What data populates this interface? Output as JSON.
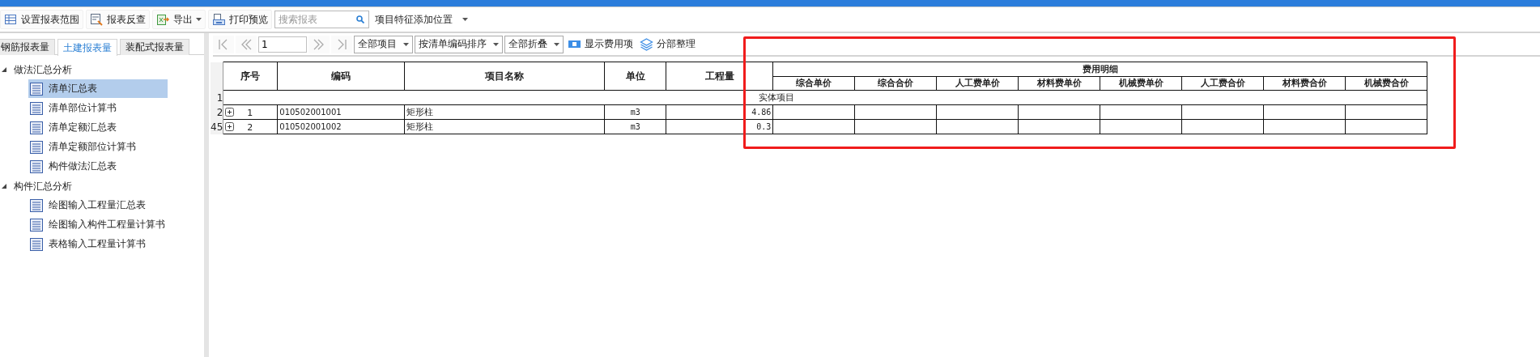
{
  "toolbar": [
    {
      "kind": "button",
      "label": "设置报表范围"
    },
    {
      "kind": "button",
      "label": "报表反查"
    },
    {
      "kind": "menu",
      "label": "导出"
    },
    {
      "kind": "button",
      "label": "打印预览"
    }
  ],
  "search": {
    "placeholder": "搜索报表"
  },
  "position_dropdown": {
    "value": "项目特征添加位置"
  },
  "tabs": [
    {
      "label": "钢筋报表量",
      "selected": false
    },
    {
      "label": "土建报表量",
      "selected": true
    },
    {
      "label": "装配式报表量",
      "selected": false
    }
  ],
  "tree": [
    {
      "label": "做法汇总分析",
      "expanded": true,
      "children": [
        {
          "label": "清单汇总表",
          "selected": true
        },
        {
          "label": "清单部位计算书",
          "selected": false
        },
        {
          "label": "清单定额汇总表",
          "selected": false
        },
        {
          "label": "清单定额部位计算书",
          "selected": false
        },
        {
          "label": "构件做法汇总表",
          "selected": false
        }
      ]
    },
    {
      "label": "构件汇总分析",
      "expanded": true,
      "children": [
        {
          "label": "绘图输入工程量汇总表",
          "selected": false
        },
        {
          "label": "绘图输入构件工程量计算书",
          "selected": false
        },
        {
          "label": "表格输入工程量计算书",
          "selected": false
        }
      ]
    }
  ],
  "pager": {
    "page": "1"
  },
  "filters": [
    {
      "value": "全部项目"
    },
    {
      "value": "按清单编码排序"
    },
    {
      "value": "全部折叠"
    }
  ],
  "actions": [
    {
      "label": "显示费用项"
    },
    {
      "label": "分部整理"
    }
  ],
  "table": {
    "columns": [
      "序号",
      "编码",
      "项目名称",
      "单位",
      "工程量"
    ],
    "fee_group": "费用明细",
    "fee_columns": [
      "综合单价",
      "综合合价",
      "人工费单价",
      "材料费单价",
      "机械费单价",
      "人工费合价",
      "材料费合价",
      "机械费合价"
    ],
    "rows": [
      {
        "kind": "group",
        "row_header": "1",
        "label": "实体项目"
      },
      {
        "kind": "item",
        "row_header": "2",
        "expanded": false,
        "cells": [
          "1",
          "010502001001",
          "矩形柱",
          "m3",
          "4.86"
        ]
      },
      {
        "kind": "item",
        "row_header": "45",
        "expanded": false,
        "cells": [
          "2",
          "010502001002",
          "矩形柱",
          "m3",
          "0.3"
        ]
      }
    ]
  },
  "annotations": [
    {
      "kind": "frame"
    }
  ]
}
